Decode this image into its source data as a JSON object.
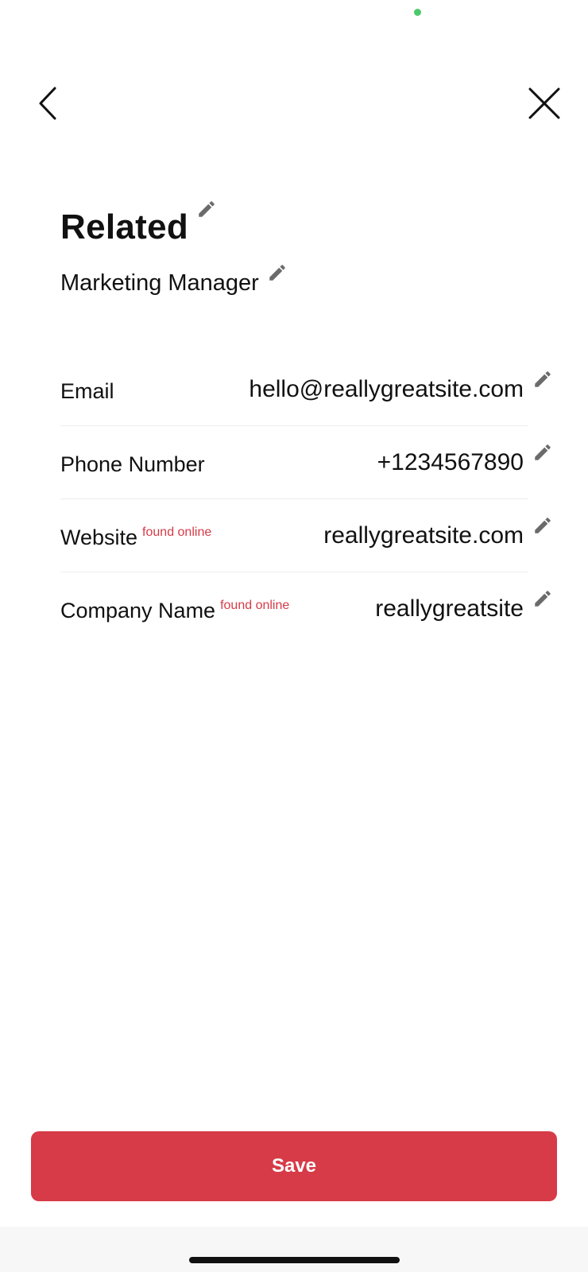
{
  "colors": {
    "accent": "#d63b47",
    "status_dot": "#4cc96c",
    "pencil": "#6b6b6b",
    "icon_stroke": "#111111"
  },
  "header": {
    "back_icon": "chevron-left-icon",
    "close_icon": "close-icon"
  },
  "contact": {
    "name": "Related",
    "job_title": "Marketing Manager"
  },
  "fields": [
    {
      "label": "Email",
      "tag": "",
      "value": "hello@reallygreatsite.com"
    },
    {
      "label": "Phone Number",
      "tag": "",
      "value": "+1234567890"
    },
    {
      "label": "Website",
      "tag": "found online",
      "value": "reallygreatsite.com"
    },
    {
      "label": "Company Name",
      "tag": "found online",
      "value": "reallygreatsite"
    }
  ],
  "footer": {
    "save_label": "Save"
  }
}
